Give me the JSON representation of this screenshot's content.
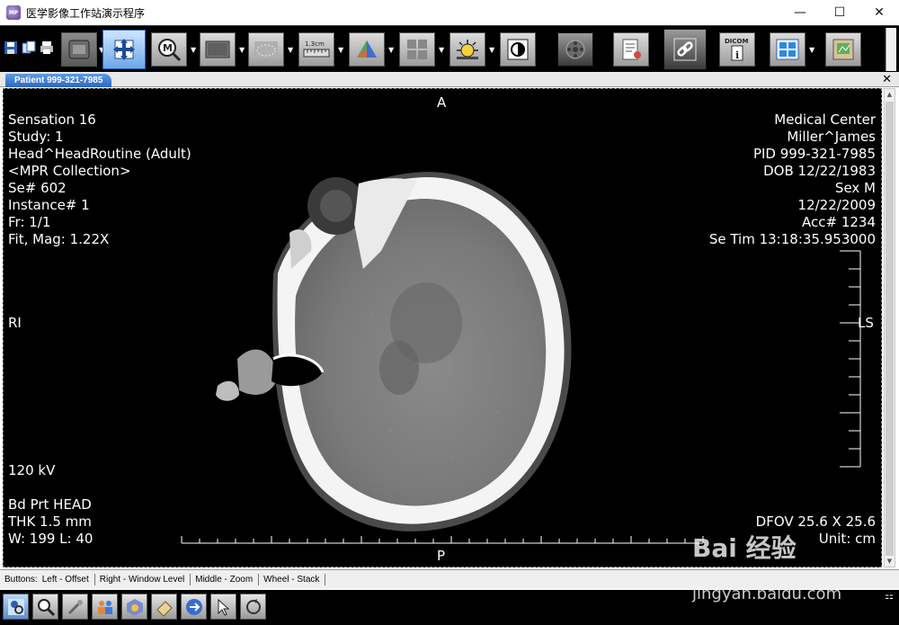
{
  "window": {
    "title": "医学影像工作站演示程序",
    "app_icon_text": "MP"
  },
  "tab": {
    "label": "Patient 999-321-7985"
  },
  "toolbar": {
    "buttons": [
      "layout-icon",
      "pan-icon",
      "magnify-icon",
      "window-level-icon",
      "roi-icon",
      "ruler-icon",
      "3d-icon",
      "grid-icon",
      "brightness-icon",
      "invert-icon",
      "film-icon",
      "report-icon",
      "link-icon",
      "dicom-info-icon",
      "series-layout-icon",
      "export-icon"
    ],
    "ruler_label": "1.3cm",
    "dicom_label": "DICOM"
  },
  "overlay": {
    "top_left": [
      "Sensation 16",
      "Study: 1",
      "Head^HeadRoutine (Adult)",
      "<MPR Collection>",
      "Se# 602",
      "Instance# 1",
      "Fr: 1/1",
      "Fit, Mag: 1.22X"
    ],
    "top_right": [
      "Medical Center",
      "Miller^James",
      "PID 999-321-7985",
      "DOB 12/22/1983",
      "Sex M",
      "12/22/2009",
      "Acc# 1234",
      "Se Tim 13:18:35.953000"
    ],
    "bottom_left": [
      "Bd Prt HEAD",
      "THK 1.5 mm",
      "W: 199 L: 40"
    ],
    "kv": "120 kV",
    "bottom_right": [
      "DFOV 25.6 X 25.6",
      "Unit:  cm"
    ],
    "orient_top": "A",
    "orient_bottom": "P",
    "orient_left": "RI",
    "orient_right": "LS"
  },
  "status": {
    "buttons": "Buttons:",
    "left": "Left -  Offset",
    "right": "Right -  Window Level",
    "middle": "Middle -  Zoom",
    "wheel": "Wheel -  Stack"
  },
  "bottom_toolbar": [
    "patient-search-icon",
    "zoom-search-icon",
    "tools-icon",
    "users-icon",
    "settings-cube-icon",
    "eraser-icon",
    "next-arrow-icon",
    "pointer-icon",
    "refresh-icon"
  ],
  "watermark": {
    "brand": "Bai 经验",
    "url": "jingyan.baidu.com"
  }
}
